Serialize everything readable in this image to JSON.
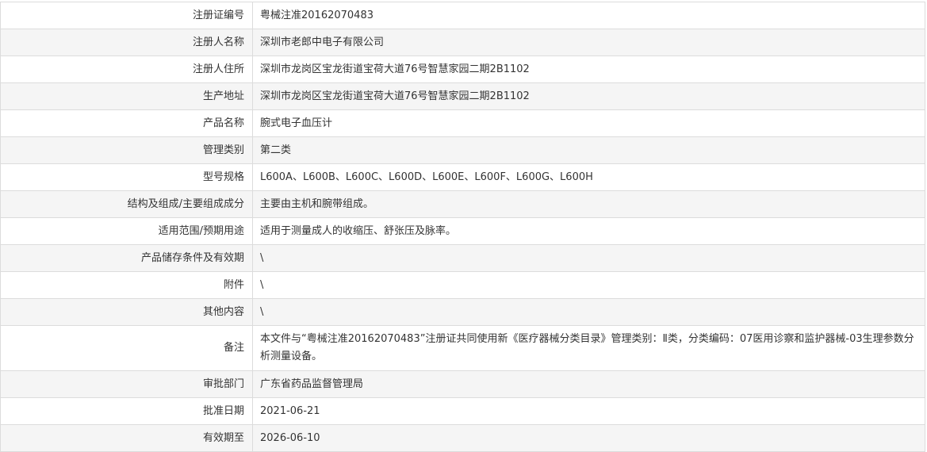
{
  "colors": {
    "row_alt_background": "#f5f5f5",
    "row_background": "#ffffff",
    "border": "#dcdcdc",
    "text": "#333333"
  },
  "rows": [
    {
      "label": "注册证编号",
      "value": "粤械注准20162070483"
    },
    {
      "label": "注册人名称",
      "value": "深圳市老郎中电子有限公司"
    },
    {
      "label": "注册人住所",
      "value": "深圳市龙岗区宝龙街道宝荷大道76号智慧家园二期2B1102"
    },
    {
      "label": "生产地址",
      "value": "深圳市龙岗区宝龙街道宝荷大道76号智慧家园二期2B1102"
    },
    {
      "label": "产品名称",
      "value": "腕式电子血压计"
    },
    {
      "label": "管理类别",
      "value": "第二类"
    },
    {
      "label": "型号规格",
      "value": "L600A、L600B、L600C、L600D、L600E、L600F、L600G、L600H"
    },
    {
      "label": "结构及组成/主要组成成分",
      "value": "主要由主机和腕带组成。"
    },
    {
      "label": "适用范围/预期用途",
      "value": "适用于测量成人的收缩压、舒张压及脉率。"
    },
    {
      "label": "产品储存条件及有效期",
      "value": "\\"
    },
    {
      "label": "附件",
      "value": "\\"
    },
    {
      "label": "其他内容",
      "value": "\\"
    },
    {
      "label": "备注",
      "value": "本文件与“粤械注准20162070483”注册证共同使用新《医疗器械分类目录》管理类别：Ⅱ类，分类编码：07医用诊察和监护器械-03生理参数分析测量设备。"
    },
    {
      "label": "审批部门",
      "value": "广东省药品监督管理局"
    },
    {
      "label": "批准日期",
      "value": "2021-06-21"
    },
    {
      "label": "有效期至",
      "value": "2026-06-10"
    }
  ]
}
